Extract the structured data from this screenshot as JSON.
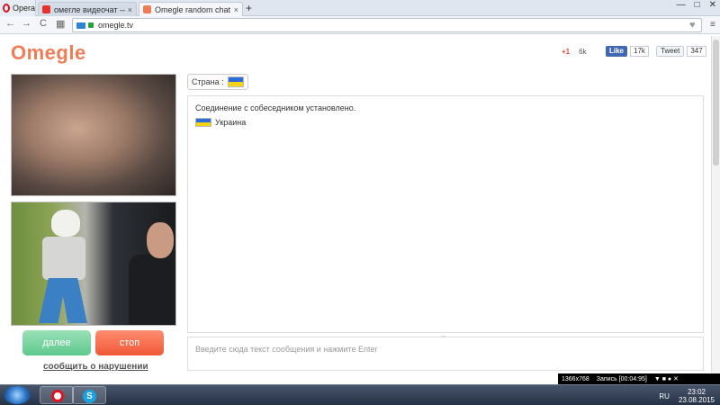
{
  "browser": {
    "app_label": "Opera",
    "tabs": [
      {
        "title": "омегле видеочат — Янд",
        "close": "×"
      },
      {
        "title": "Omegle random chat",
        "close": "×"
      }
    ],
    "new_tab": "+",
    "window_controls": {
      "minimize": "—",
      "maximize": "□",
      "close": "✕"
    },
    "nav": {
      "back": "←",
      "forward": "→",
      "reload": "C",
      "grid": "▦"
    },
    "url": "omegle.tv",
    "heart": "♥",
    "menu": "≡"
  },
  "page": {
    "logo": "Omegle",
    "social": {
      "gplus_label": "+1",
      "gplus_count": "6k",
      "fb_like": "Like",
      "fb_count": "17k",
      "tweet": "Tweet",
      "tweet_count": "347"
    },
    "buttons": {
      "next": "далее",
      "stop": "стоп"
    },
    "report_link": "сообщить о нарушении",
    "country_label": "Страна :",
    "chat": {
      "connected_msg": "Соединение с собеседником установлено.",
      "country_name": "Украина"
    },
    "message_placeholder": "Введите сюда текст сообщения и нажмите Enter",
    "resize_handle": "═"
  },
  "recorder": {
    "resolution": "1366x768",
    "status": "Запись [00:04:95]",
    "controls": "▼ ■ ● ✕"
  },
  "taskbar": {
    "lang": "RU",
    "time": "23:02",
    "date": "23.08.2015"
  },
  "colors": {
    "logo": "#f07c56",
    "next_btn": "#5ec98d",
    "stop_btn": "#ef5836",
    "fb": "#4267b2",
    "gplus": "#dd4b39"
  }
}
